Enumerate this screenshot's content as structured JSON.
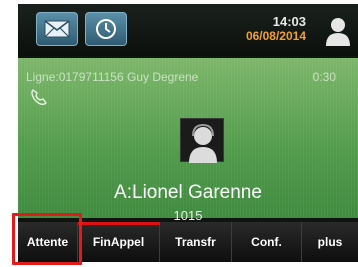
{
  "status": {
    "time": "14:03",
    "date": "06/08/2014",
    "icons": [
      "mail-icon",
      "clock-icon",
      "user-icon"
    ]
  },
  "call": {
    "line_info": "Ligne:0179711156 Guy Degrene",
    "duration": "0:30",
    "callee": "A:Lionel Garenne",
    "number": "1015"
  },
  "softkeys": [
    {
      "label": "Attente"
    },
    {
      "label": "FinAppel"
    },
    {
      "label": "Transfr"
    },
    {
      "label": "Conf."
    },
    {
      "label": "plus"
    }
  ],
  "colors": {
    "panel_green": "#5ca652",
    "date_orange": "#f0a030",
    "highlight_red": "#e01b1b"
  }
}
